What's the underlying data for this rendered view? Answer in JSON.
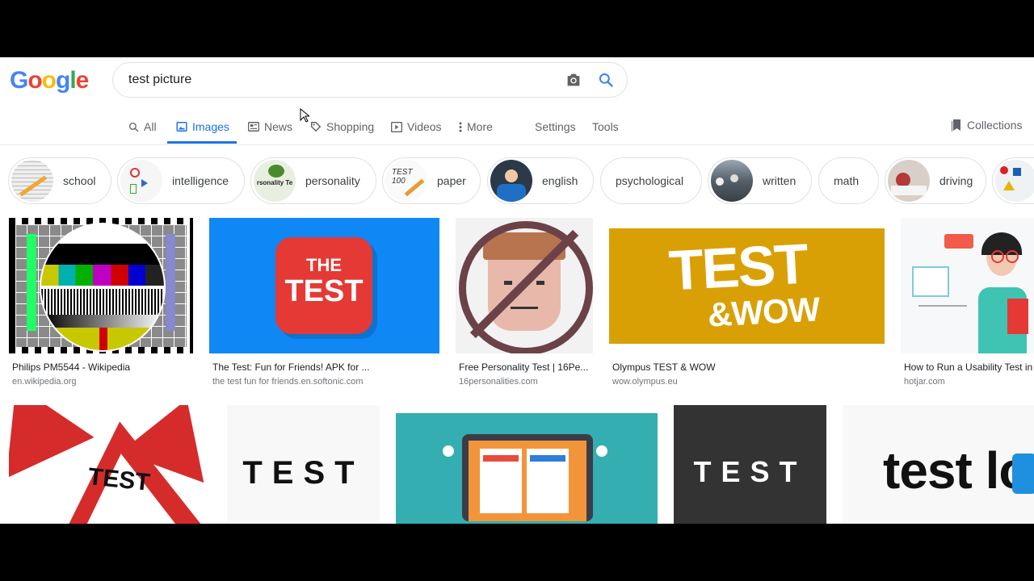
{
  "logo": {
    "text": "Google"
  },
  "search": {
    "query": "test picture",
    "camera_icon": "camera-icon",
    "search_icon": "search-icon"
  },
  "tabs": [
    {
      "label": "All",
      "icon": "search-icon"
    },
    {
      "label": "Images",
      "icon": "image-icon",
      "active": true
    },
    {
      "label": "News",
      "icon": "news-icon"
    },
    {
      "label": "Shopping",
      "icon": "tag-icon"
    },
    {
      "label": "Videos",
      "icon": "play-icon"
    },
    {
      "label": "More",
      "icon": "vertical-dots-icon"
    },
    {
      "label": "Settings"
    },
    {
      "label": "Tools"
    }
  ],
  "collections": {
    "label": "Collections",
    "icon": "bookmark-icon"
  },
  "chips": [
    {
      "label": "school"
    },
    {
      "label": "intelligence"
    },
    {
      "label": "personality",
      "thumb_text": "rsonality Te"
    },
    {
      "label": "paper",
      "thumb_text": "TEST 100"
    },
    {
      "label": "english"
    },
    {
      "label": "psychological"
    },
    {
      "label": "written"
    },
    {
      "label": "math"
    },
    {
      "label": "driving"
    }
  ],
  "results_row1": [
    {
      "title": "Philips PM5544 - Wikipedia",
      "site": "en.wikipedia.org"
    },
    {
      "title": "The Test: Fun for Friends! APK for ...",
      "site": "the test fun for friends.en.softonic.com",
      "image_text": [
        "THE",
        "TEST"
      ]
    },
    {
      "title": "Free Personality Test | 16Pe...",
      "site": "16personalities.com"
    },
    {
      "title": "Olympus TEST & WOW",
      "site": "wow.olympus.eu",
      "image_text": [
        "TEST",
        "&WOW"
      ]
    },
    {
      "title": "How to Run a Usability Test in",
      "site": "hotjar.com"
    }
  ],
  "results_row2": [
    {
      "image_text": "TEST"
    },
    {
      "image_text": "TEST"
    },
    {
      "image_text": ""
    },
    {
      "image_text": "TEST"
    },
    {
      "image_text": "test lo"
    }
  ],
  "colors": {
    "accent": "#1a73e8",
    "link_gray": "#5f6368",
    "border": "#dfe1e5"
  }
}
